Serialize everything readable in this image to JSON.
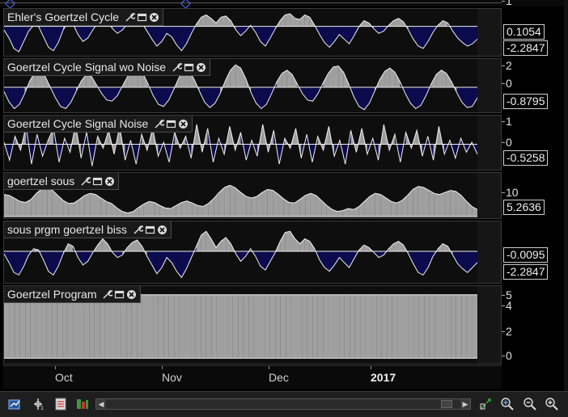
{
  "panes": [
    {
      "title": "Ehler's Goertzel Cycle",
      "ticks": [
        "1"
      ],
      "value_boxes": [
        "0.1054",
        "-2.2847"
      ],
      "series_range": [
        -2.3,
        1.2
      ],
      "zero": 0.1054,
      "series": [
        -0.2,
        -0.9,
        -1.8,
        -2.1,
        -1.2,
        -0.3,
        0.2,
        0.1,
        -0.8,
        -1.7,
        -2.0,
        -1.3,
        -0.2,
        0.5,
        0.3,
        -0.6,
        -1.2,
        -0.9,
        -0.2,
        0.4,
        0.9,
        0.6,
        -0.1,
        -0.5,
        -0.2,
        0.3,
        0.7,
        0.8,
        0.4,
        -0.3,
        -1.0,
        -1.6,
        -1.2,
        -0.5,
        -0.8,
        -1.5,
        -2.0,
        -1.4,
        -0.5,
        0.3,
        0.9,
        1.1,
        0.8,
        0.4,
        0.9,
        1.0,
        0.6,
        -0.2,
        -0.7,
        -0.3,
        0.2,
        -0.4,
        -1.2,
        -1.6,
        -0.9,
        -0.1,
        0.6,
        1.1,
        1.2,
        0.8,
        0.7,
        1.1,
        0.9,
        0.2,
        -0.6,
        -1.3,
        -1.7,
        -1.2,
        -0.6,
        -1.0,
        -1.4,
        -0.7,
        0.1,
        0.6,
        0.4,
        -0.1,
        -0.5,
        -0.3,
        0.2,
        0.6,
        0.8,
        0.5,
        -0.2,
        -1.0,
        -1.6,
        -1.8,
        -1.2,
        -0.4,
        0.2,
        0.6,
        0.4,
        -0.3,
        -0.9,
        -1.3,
        -1.6,
        -1.4,
        -1.0
      ]
    },
    {
      "title": "Goertzel Cycle Signal wo Noise",
      "ticks": [
        "2",
        "0"
      ],
      "value_boxes": [
        "-0.8795"
      ],
      "series_range": [
        -2.2,
        2.2
      ],
      "zero": 0,
      "series": [
        -0.4,
        -1.4,
        -2.0,
        -1.6,
        -0.6,
        0.6,
        1.4,
        1.6,
        1.0,
        0.0,
        -1.0,
        -1.8,
        -2.0,
        -1.4,
        -0.4,
        0.6,
        1.2,
        1.0,
        0.2,
        -0.6,
        -1.2,
        -1.3,
        -0.8,
        0.1,
        1.0,
        1.7,
        1.9,
        1.3,
        0.3,
        -0.8,
        -1.6,
        -1.8,
        -1.2,
        -0.2,
        0.9,
        1.6,
        1.5,
        0.7,
        -0.4,
        -1.4,
        -1.9,
        -1.5,
        -0.6,
        0.6,
        1.6,
        2.1,
        1.8,
        0.8,
        -0.5,
        -1.5,
        -2.0,
        -1.6,
        -0.6,
        0.5,
        1.3,
        1.6,
        1.2,
        0.3,
        -0.6,
        -1.2,
        -1.3,
        -0.6,
        0.4,
        1.3,
        1.9,
        2.0,
        1.4,
        0.3,
        -0.9,
        -1.8,
        -2.1,
        -1.5,
        -0.4,
        0.7,
        1.5,
        1.8,
        1.4,
        0.5,
        -0.6,
        -1.5,
        -2.0,
        -1.7,
        -0.8,
        0.3,
        1.2,
        1.6,
        1.3,
        0.5,
        -0.5,
        -1.4,
        -1.9,
        -1.8,
        -1.0
      ]
    },
    {
      "title": "Goertzel Cycle Signal Noise",
      "ticks": [
        "1",
        "0"
      ],
      "value_boxes": [
        "-0.5258"
      ],
      "series_range": [
        -1.2,
        1.2
      ],
      "zero": 0,
      "series": [
        0.1,
        -0.8,
        0.4,
        -0.3,
        0.9,
        -1.0,
        0.5,
        -0.6,
        0.2,
        0.8,
        -0.9,
        0.3,
        -0.4,
        1.0,
        -0.7,
        0.6,
        -1.1,
        0.4,
        -0.2,
        0.7,
        -0.5,
        0.9,
        -0.8,
        0.2,
        -1.0,
        0.5,
        -0.3,
        0.8,
        -0.6,
        0.1,
        -0.9,
        0.6,
        -0.2,
        0.4,
        -0.7,
        1.0,
        -0.4,
        0.8,
        -0.9,
        0.3,
        -0.5,
        0.9,
        -0.3,
        0.6,
        -0.8,
        0.2,
        -0.6,
        1.0,
        -0.4,
        0.7,
        -1.0,
        0.3,
        -0.2,
        0.8,
        -0.7,
        0.5,
        -0.9,
        0.4,
        -0.3,
        0.9,
        -0.6,
        0.2,
        -1.0,
        0.7,
        -0.4,
        0.8,
        -0.5,
        0.3,
        -0.8,
        1.0,
        -0.3,
        0.5,
        -0.9,
        0.6,
        -0.2,
        0.7,
        -0.6,
        0.4,
        -0.8,
        0.9,
        -0.5,
        0.2,
        -0.7,
        0.3,
        -0.4,
        0.1,
        -0.5
      ]
    },
    {
      "title": "goertzel sous",
      "ticks": [
        "10"
      ],
      "value_boxes": [
        "5.2636"
      ],
      "series_range": [
        3.8,
        11.5
      ],
      "zero": 3.8,
      "series": [
        8.2,
        8.0,
        7.4,
        6.8,
        6.6,
        7.2,
        8.4,
        9.3,
        9.6,
        9.0,
        8.0,
        7.0,
        6.4,
        6.5,
        7.2,
        8.0,
        8.4,
        8.2,
        7.5,
        6.8,
        6.4,
        5.5,
        4.8,
        4.5,
        4.8,
        5.6,
        6.3,
        6.8,
        6.6,
        6.0,
        5.5,
        5.4,
        6.0,
        6.6,
        6.9,
        6.5,
        6.0,
        5.8,
        6.4,
        7.4,
        8.6,
        9.6,
        10.0,
        9.5,
        8.6,
        7.8,
        7.5,
        7.8,
        8.6,
        9.2,
        9.0,
        8.2,
        7.3,
        6.6,
        6.5,
        7.2,
        8.0,
        8.4,
        8.0,
        7.0,
        6.0,
        5.2,
        4.8,
        5.0,
        5.4,
        5.2,
        5.8,
        6.8,
        7.8,
        8.4,
        8.2,
        7.5,
        6.8,
        6.5,
        7.0,
        8.0,
        9.2,
        9.8,
        9.6,
        9.0,
        8.4,
        8.2,
        8.6,
        9.0,
        8.8,
        8.0,
        6.8,
        5.8,
        5.2
      ]
    },
    {
      "title": "sous prgm goertzel biss",
      "ticks": [],
      "value_boxes": [
        "-0.0095",
        "-2.2847"
      ],
      "series_range": [
        -2.4,
        2.0
      ],
      "zero": -0.0095,
      "series": [
        -0.2,
        -0.9,
        -1.7,
        -1.9,
        -1.2,
        -0.3,
        0.2,
        0.1,
        -0.7,
        -1.6,
        -1.9,
        -1.2,
        -0.2,
        0.6,
        0.4,
        -0.5,
        -1.1,
        -0.8,
        -0.1,
        0.5,
        1.0,
        0.6,
        -0.1,
        -0.5,
        -0.3,
        0.3,
        0.7,
        0.9,
        0.4,
        -0.4,
        -1.1,
        -1.8,
        -1.3,
        -0.5,
        -0.9,
        -1.6,
        -2.1,
        -1.4,
        -0.5,
        0.4,
        1.3,
        1.6,
        1.0,
        0.3,
        0.8,
        1.1,
        0.6,
        -0.2,
        -0.8,
        -0.4,
        0.2,
        -0.4,
        -1.2,
        -1.5,
        -0.8,
        -0.1,
        0.8,
        1.5,
        1.6,
        1.0,
        0.6,
        1.0,
        0.8,
        0.2,
        -0.7,
        -1.3,
        -1.6,
        -1.1,
        -0.5,
        -0.9,
        -1.3,
        -0.6,
        0.1,
        0.5,
        0.3,
        -0.1,
        -0.5,
        -0.3,
        0.2,
        0.6,
        0.8,
        0.5,
        -0.2,
        -1.0,
        -1.7,
        -1.9,
        -1.3,
        -0.4,
        0.2,
        0.6,
        0.4,
        -0.3,
        -1.0,
        -1.4,
        -1.7,
        -1.3,
        -0.9
      ]
    },
    {
      "title": "Goertzel Program",
      "ticks": [
        "5",
        "4",
        "2",
        "0"
      ],
      "value_boxes": [],
      "series_range": [
        -0.3,
        5.3
      ],
      "zero": 0,
      "series": [
        5,
        5,
        5,
        5,
        5,
        5,
        5,
        5,
        5,
        5,
        5,
        5,
        5,
        5,
        5,
        5,
        5,
        5,
        5,
        5,
        5,
        5,
        5,
        5,
        5,
        5,
        5,
        5,
        5,
        5,
        5,
        5,
        5,
        5,
        5,
        5,
        5,
        5,
        5,
        5,
        5,
        5,
        5,
        5,
        5,
        5,
        5,
        5,
        5,
        5,
        5,
        5,
        5,
        5,
        5,
        5,
        5,
        5,
        5,
        5,
        5,
        5,
        5,
        5,
        5,
        5,
        5,
        5,
        5,
        5,
        5,
        5,
        5,
        5,
        5,
        5,
        5,
        5,
        5,
        5,
        5,
        5,
        5,
        5,
        5,
        5,
        5,
        5,
        5,
        5
      ]
    }
  ],
  "time_axis": {
    "months": [
      {
        "label": "Oct",
        "bold": false
      },
      {
        "label": "Nov",
        "bold": false
      },
      {
        "label": "Dec",
        "bold": false
      },
      {
        "label": "2017",
        "bold": true
      }
    ]
  },
  "toolbar": {
    "icons": [
      "chart-edit-icon",
      "crosshair-icon",
      "data-window-icon",
      "indicator-icon",
      "scroll-left-icon",
      "scroll-right-icon",
      "expand-icon",
      "zoom-fit-icon",
      "zoom-out-icon",
      "zoom-in-icon"
    ]
  },
  "colors": {
    "positive_fill": "#a0a0a0",
    "negative_fill": "#0b0b4e",
    "line": "#f0f0f0",
    "background": "#000000"
  }
}
